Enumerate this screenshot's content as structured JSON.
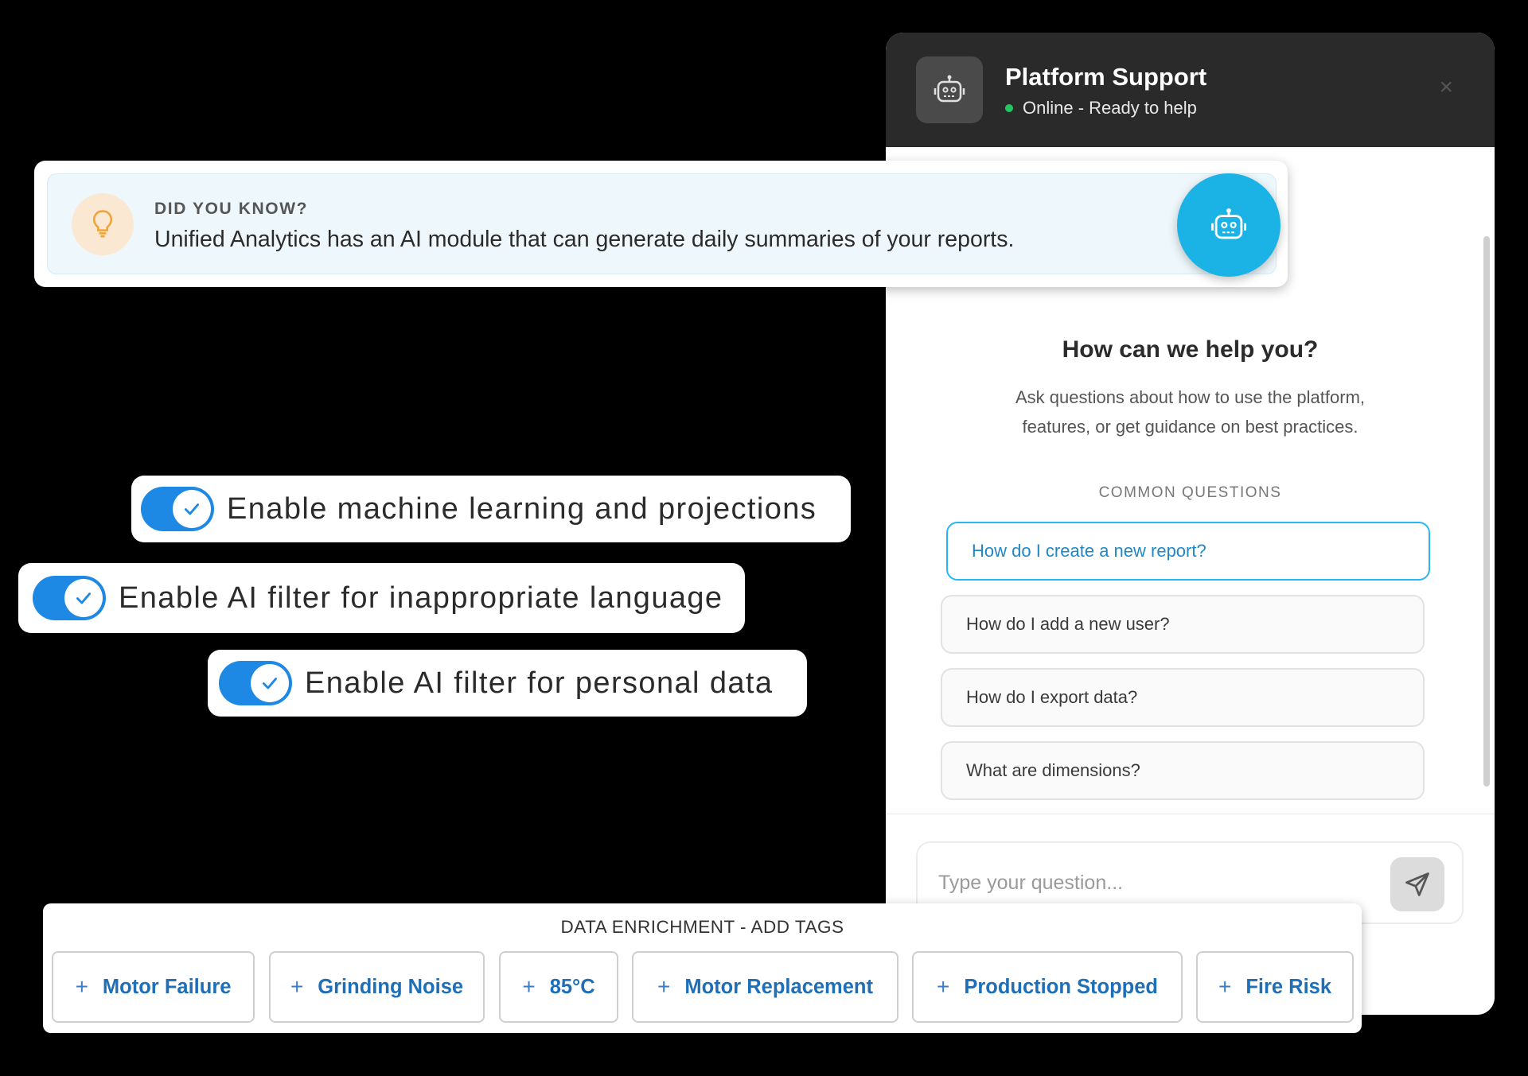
{
  "chat": {
    "title": "Platform Support",
    "status": "Online - Ready to help",
    "close_icon": "×",
    "help_title": "How can we help you?",
    "help_desc_line1": "Ask questions about how to use the platform,",
    "help_desc_line2": "features, or get guidance on best practices.",
    "common_label": "COMMON QUESTIONS",
    "questions": [
      "How do I create a new report?",
      "How do I add a new user?",
      "How do I export data?",
      "What are dimensions?"
    ],
    "input_placeholder": "Type your question...",
    "icons": {
      "avatar": "robot-icon",
      "send": "send-icon",
      "close": "close-icon"
    }
  },
  "tip": {
    "heading": "DID YOU KNOW?",
    "text": "Unified Analytics has an AI module that can generate daily summaries of your reports.",
    "icon": "lightbulb-icon"
  },
  "toggles": [
    {
      "label": "Enable machine learning and projections",
      "on": true
    },
    {
      "label": "Enable AI filter for inappropriate language",
      "on": true
    },
    {
      "label": "Enable AI filter for personal data",
      "on": true
    }
  ],
  "tags": {
    "title": "DATA ENRICHMENT - ADD TAGS",
    "plus": "+",
    "items": [
      "Motor Failure",
      "Grinding Noise",
      "85°C",
      "Motor Replacement",
      "Production Stopped",
      "Fire Risk"
    ]
  },
  "colors": {
    "accent": "#1e88e5",
    "fab": "#1bb3e6",
    "online": "#22c55e",
    "header": "#2a2a2a",
    "tag_text": "#1e6fb8"
  }
}
